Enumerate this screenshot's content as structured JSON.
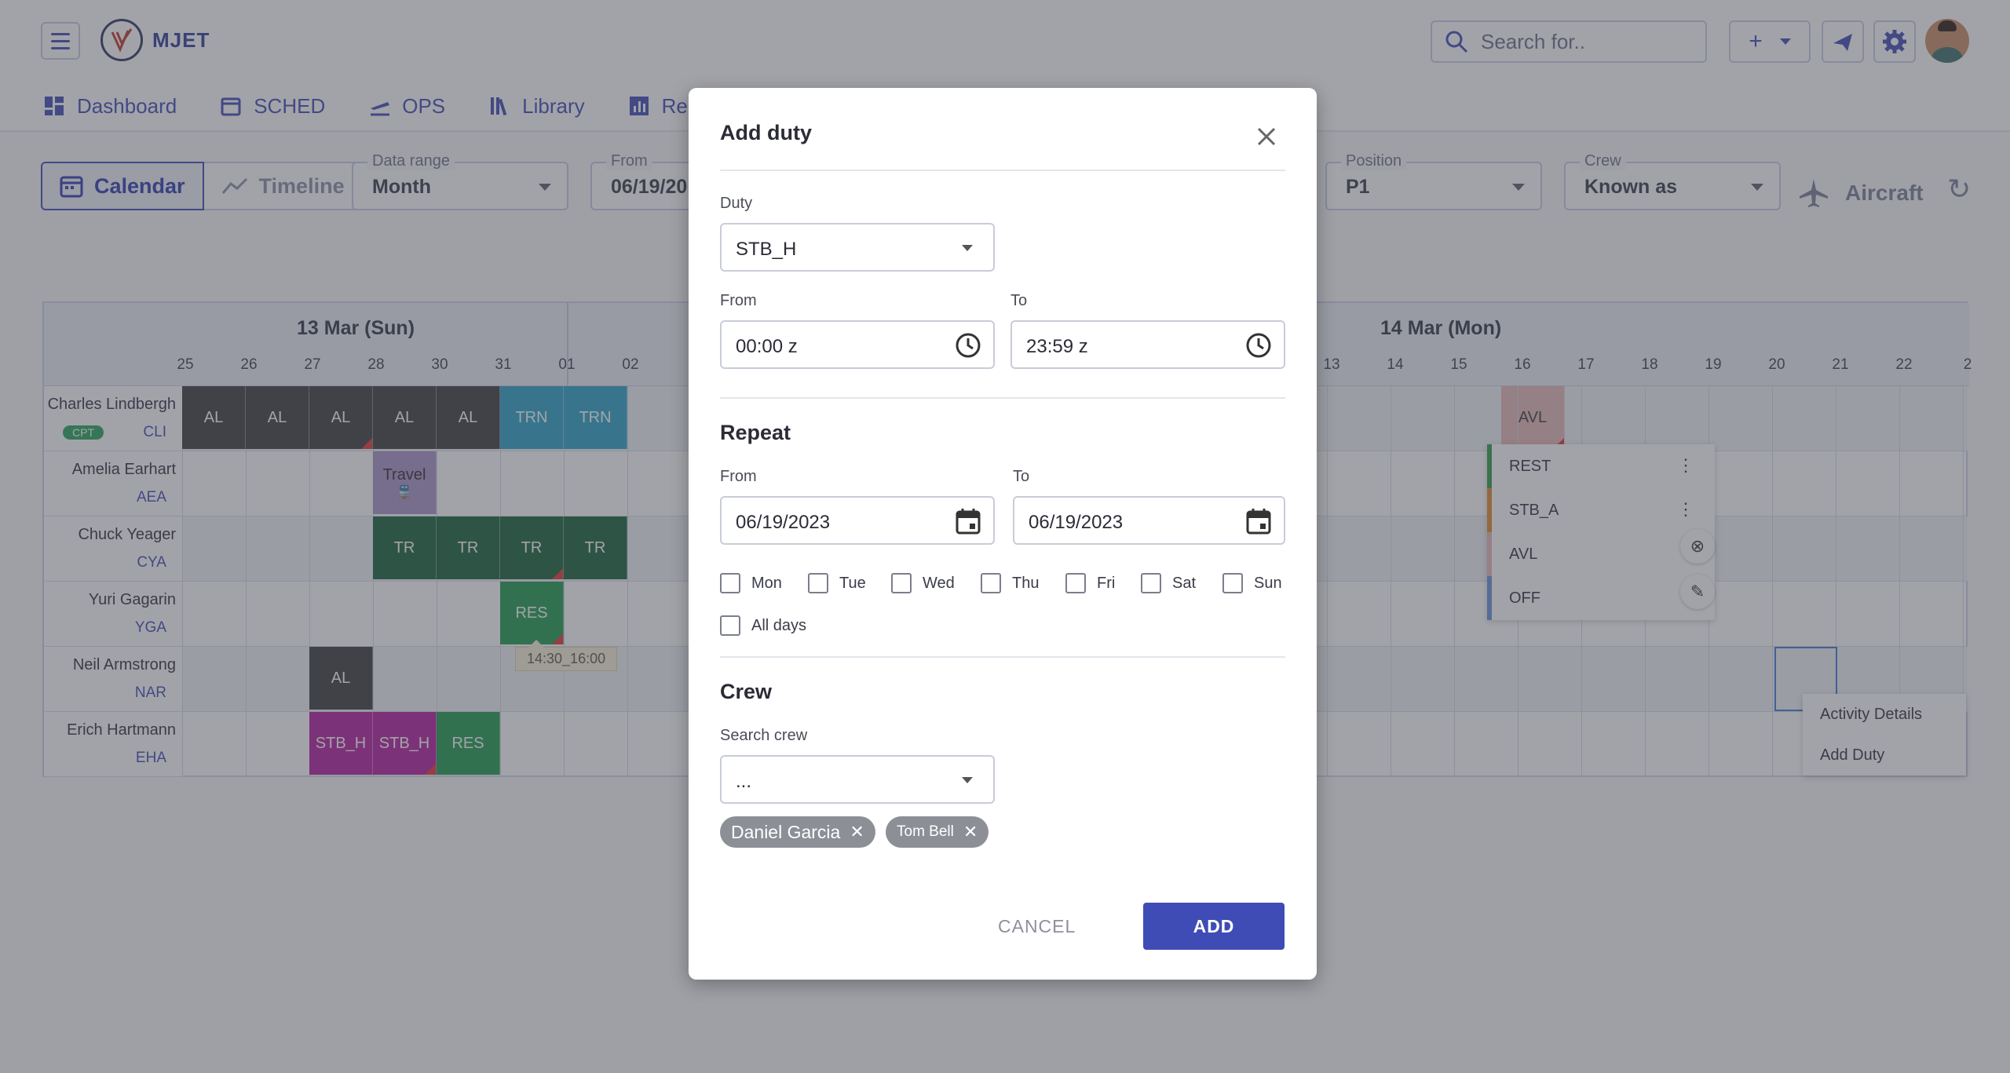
{
  "app": {
    "name": "MJET",
    "search_placeholder": "Search for.."
  },
  "nav": [
    "Dashboard",
    "SCHED",
    "OPS",
    "Library",
    "Repo"
  ],
  "filters": {
    "view_calendar": "Calendar",
    "view_timeline": "Timeline",
    "data_range": {
      "label": "Data range",
      "value": "Month"
    },
    "from": {
      "label": "From",
      "value": "06/19/20"
    },
    "position": {
      "label": "Position",
      "value": "P1"
    },
    "crew": {
      "label": "Crew",
      "value": "Known as"
    },
    "aircraft_label": "Aircraft"
  },
  "schedule": {
    "days": [
      "13 Mar (Sun)",
      "14 Mar (Mon)"
    ],
    "hours_left": [
      "25",
      "26",
      "27",
      "28",
      "30",
      "31",
      "01",
      "02"
    ],
    "hours_right": [
      "13",
      "14",
      "15",
      "16",
      "17",
      "18",
      "19",
      "20",
      "21",
      "22",
      "2"
    ],
    "crew": [
      {
        "name": "Charles Lindbergh",
        "code": "CLI",
        "badge": "CPT"
      },
      {
        "name": "Amelia Earhart",
        "code": "AEA",
        "badge": ""
      },
      {
        "name": "Chuck Yeager",
        "code": "CYA",
        "badge": ""
      },
      {
        "name": "Yuri Gagarin",
        "code": "YGA",
        "badge": ""
      },
      {
        "name": "Neil Armstrong",
        "code": "NAR",
        "badge": ""
      },
      {
        "name": "Erich Hartmann",
        "code": "EHA",
        "badge": ""
      }
    ],
    "duties": [
      {
        "row": 0,
        "col": 0,
        "label": "AL",
        "color": "#3d3d3d",
        "flag": false
      },
      {
        "row": 0,
        "col": 1,
        "label": "AL",
        "color": "#3d3d3d",
        "flag": false
      },
      {
        "row": 0,
        "col": 2,
        "label": "AL",
        "color": "#3d3d3d",
        "flag": true
      },
      {
        "row": 0,
        "col": 3,
        "label": "AL",
        "color": "#3d3d3d",
        "flag": false
      },
      {
        "row": 0,
        "col": 4,
        "label": "AL",
        "color": "#3d3d3d",
        "flag": false
      },
      {
        "row": 0,
        "col": 5,
        "label": "TRN",
        "color": "#2aa3c9",
        "flag": false
      },
      {
        "row": 0,
        "col": 6,
        "label": "TRN",
        "color": "#2aa3c9",
        "flag": false
      },
      {
        "row": 1,
        "col": 3,
        "label": "Travel",
        "color": "#a893c9",
        "flag": false
      },
      {
        "row": 2,
        "col": 3,
        "label": "TR",
        "color": "#17613a",
        "flag": false
      },
      {
        "row": 2,
        "col": 4,
        "label": "TR",
        "color": "#17613a",
        "flag": false
      },
      {
        "row": 2,
        "col": 5,
        "label": "TR",
        "color": "#17613a",
        "flag": true
      },
      {
        "row": 2,
        "col": 6,
        "label": "TR",
        "color": "#17613a",
        "flag": false
      },
      {
        "row": 3,
        "col": 5,
        "label": "RES",
        "color": "#1f9a4e",
        "flag": true
      },
      {
        "row": 4,
        "col": 2,
        "label": "AL",
        "color": "#3d3d3d",
        "flag": false
      },
      {
        "row": 5,
        "col": 2,
        "label": "STB_H",
        "color": "#b21d9e",
        "flag": false
      },
      {
        "row": 5,
        "col": 3,
        "label": "STB_H",
        "color": "#b21d9e",
        "flag": true
      },
      {
        "row": 5,
        "col": 4,
        "label": "RES",
        "color": "#1f9a4e",
        "flag": false
      }
    ],
    "avl_label": "AVL",
    "tooltip": "14:30_16:00",
    "ctx_list": [
      {
        "label": "REST",
        "color": "#2e9a4a"
      },
      {
        "label": "STB_A",
        "color": "#e08a2c"
      },
      {
        "label": "AVL",
        "color": "#e4b8b8"
      },
      {
        "label": "OFF",
        "color": "#6a8fd8"
      }
    ],
    "ctx_menu": [
      "Activity Details",
      "Add Duty"
    ]
  },
  "dialog": {
    "title": "Add duty",
    "duty": {
      "label": "Duty",
      "value": "STB_H"
    },
    "time_from": {
      "label": "From",
      "value": "00:00 z"
    },
    "time_to": {
      "label": "To",
      "value": "23:59  z"
    },
    "repeat": {
      "title": "Repeat",
      "from": {
        "label": "From",
        "value": "06/19/2023"
      },
      "to": {
        "label": "To",
        "value": "06/19/2023"
      },
      "days": [
        "Mon",
        "Tue",
        "Wed",
        "Thu",
        "Fri",
        "Sat",
        "Sun"
      ],
      "all_days": "All days"
    },
    "crew": {
      "title": "Crew",
      "search_label": "Search crew",
      "search_value": "...",
      "chips": [
        "Daniel Garcia",
        "Tom Bell"
      ]
    },
    "cancel": "CANCEL",
    "add": "ADD"
  }
}
